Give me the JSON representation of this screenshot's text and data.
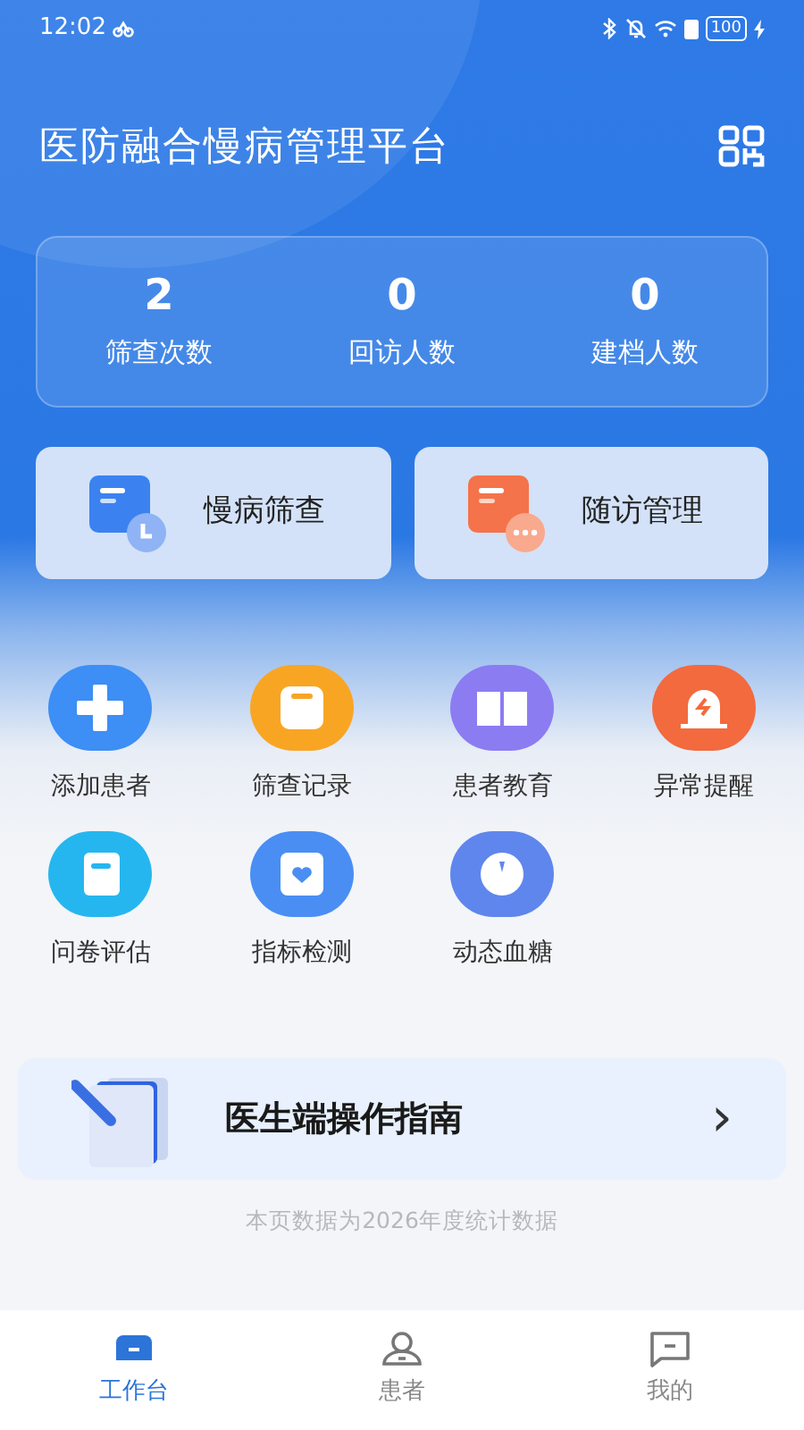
{
  "status_bar": {
    "time": "12:02",
    "battery": "100"
  },
  "header": {
    "title": "医防融合慢病管理平台"
  },
  "stats": [
    {
      "value": "2",
      "label": "筛查次数"
    },
    {
      "value": "0",
      "label": "回访人数"
    },
    {
      "value": "0",
      "label": "建档人数"
    }
  ],
  "actions": [
    {
      "label": "慢病筛查",
      "color": "#3b82f0"
    },
    {
      "label": "随访管理",
      "color": "#f5734a"
    }
  ],
  "features": [
    {
      "label": "添加患者",
      "color": "#3d8ef5"
    },
    {
      "label": "筛查记录",
      "color": "#f9a524"
    },
    {
      "label": "患者教育",
      "color": "#8b7cf2"
    },
    {
      "label": "异常提醒",
      "color": "#f26a3e"
    },
    {
      "label": "问卷评估",
      "color": "#26b6ef"
    },
    {
      "label": "指标检测",
      "color": "#4a8ef4"
    },
    {
      "label": "动态血糖",
      "color": "#5f86ec"
    }
  ],
  "guide": {
    "title": "医生端操作指南",
    "arrow": "›"
  },
  "footnote": "本页数据为2026年度统计数据",
  "tabs": [
    {
      "label": "工作台",
      "selected": true
    },
    {
      "label": "患者",
      "selected": false
    },
    {
      "label": "我的",
      "selected": false
    }
  ]
}
